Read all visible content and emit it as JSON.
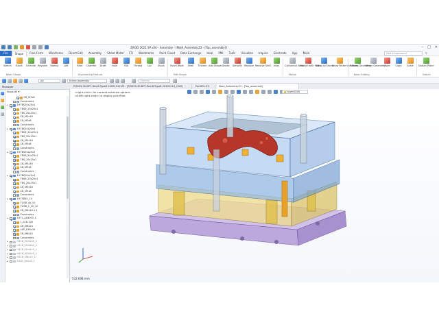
{
  "window": {
    "title": "ZW3D 2021 SP x64 - Assembly - [Mold_Assembly.Z3 - [Top_assembly]]"
  },
  "menu": {
    "file": "File",
    "tabs": [
      "Shape",
      "Free Form",
      "Wireframe",
      "Direct Edit",
      "Assembly",
      "Sheet Metal",
      "FTI",
      "Weldments",
      "Point Cloud",
      "Data Exchange",
      "Heal",
      "PMI",
      "Tools",
      "Visualize",
      "Inquire",
      "Electrode",
      "App",
      "Mold"
    ],
    "active_tab": "Shape",
    "search_placeholder": "Find a command"
  },
  "ribbon": {
    "buttons": [
      "Sketch",
      "Block",
      "Extrude",
      "Revolve",
      "Sweep",
      "Loft",
      "Fillet",
      "Chamfer",
      "Draft",
      "Hole",
      "Rib",
      "Thread",
      "Lip",
      "Stock",
      "Face Offset",
      "Shell",
      "Thicken",
      "Add Shape",
      "Divide",
      "Simplify",
      "Replace",
      "Resolve Self-I",
      "Inlay",
      "Cylindrical Bend",
      "Morph with Point",
      "Wrap to Faces",
      "Wrap Pattern to Faces",
      "Pattern Geometry",
      "Mirror Geometry",
      "Move",
      "Copy",
      "Scale",
      "Datum Plane"
    ],
    "groups": [
      "Basic Shape",
      "Engineering Feature",
      "Edit Shape",
      "Morph",
      "Basic Editing",
      "Datum"
    ]
  },
  "toolbar2": {
    "filter_all": "All",
    "assembly_select": "Entire Assembly",
    "normal_select": "Normal"
  },
  "doc_tabs": [
    "PJ3023-30-BP7-Rev.B-Type8 20201210.Z3 - [PJ3023-30-BP7-Rev.B-Type8 20201210_CAM]",
    "Part001.Z3",
    "Mold_Assembly.Z3 - [Top_assembly]"
  ],
  "active_doc_tab": 2,
  "left_panel": {
    "title": "Manager",
    "filter": "Show All",
    "tree": [
      {
        "label": "CB_M3x8",
        "indent": 2,
        "icon": "part",
        "checked": true
      },
      {
        "label": "Constraints",
        "indent": 1,
        "icon": "cst",
        "checked": false
      },
      {
        "label": "1H7BS20x25x1",
        "indent": 0,
        "icon": "asm",
        "checked": true
      },
      {
        "label": "TBS6_20x25x1",
        "indent": 1,
        "icon": "part",
        "checked": true
      },
      {
        "label": "TBS_20x25x1",
        "indent": 1,
        "icon": "part",
        "checked": true
      },
      {
        "label": "CB_M5x16",
        "indent": 1,
        "icon": "part",
        "checked": true
      },
      {
        "label": "CB_M3x8",
        "indent": 1,
        "icon": "part",
        "checked": true
      },
      {
        "label": "Constraints",
        "indent": 1,
        "icon": "cst",
        "checked": false
      },
      {
        "label": "1H7BS20x25x1",
        "indent": 0,
        "icon": "asm",
        "checked": true
      },
      {
        "label": "TBS6_20x25x1",
        "indent": 1,
        "icon": "part",
        "checked": true
      },
      {
        "label": "TBS_20x25x1",
        "indent": 1,
        "icon": "part",
        "checked": true
      },
      {
        "label": "CB_M5x16",
        "indent": 1,
        "icon": "part",
        "checked": true
      },
      {
        "label": "CB_M3x8",
        "indent": 1,
        "icon": "part",
        "checked": true
      },
      {
        "label": "Constraints",
        "indent": 1,
        "icon": "cst",
        "checked": false
      },
      {
        "label": "1H7BS20x25x1",
        "indent": 0,
        "icon": "asm",
        "checked": true
      },
      {
        "label": "TBS6_20x25x1",
        "indent": 1,
        "icon": "part",
        "checked": true
      },
      {
        "label": "TBS_20x25x1",
        "indent": 1,
        "icon": "part",
        "checked": true
      },
      {
        "label": "CB_M5x16",
        "indent": 1,
        "icon": "part",
        "checked": true
      },
      {
        "label": "CB_M3x8",
        "indent": 1,
        "icon": "part",
        "checked": true
      },
      {
        "label": "Constraints",
        "indent": 1,
        "icon": "cst",
        "checked": false
      },
      {
        "label": "1H7BS20x25x1",
        "indent": 0,
        "icon": "asm",
        "checked": true
      },
      {
        "label": "TBS6_20x25x1",
        "indent": 1,
        "icon": "part",
        "checked": true
      },
      {
        "label": "TBS_20x25x1",
        "indent": 1,
        "icon": "part",
        "checked": true
      },
      {
        "label": "CB_M5x16",
        "indent": 1,
        "icon": "part",
        "checked": true
      },
      {
        "label": "CB_M3x8",
        "indent": 1,
        "icon": "part",
        "checked": true
      },
      {
        "label": "Constraints",
        "indent": 1,
        "icon": "cst",
        "checked": false
      },
      {
        "label": "1H7SB40_10",
        "indent": 0,
        "icon": "asm",
        "checked": true
      },
      {
        "label": "TGSB_40_10",
        "indent": 1,
        "icon": "part",
        "checked": true
      },
      {
        "label": "TGSB_1_40_10",
        "indent": 1,
        "icon": "part",
        "checked": true
      },
      {
        "label": "CB_M6x16 x 4",
        "indent": 1,
        "icon": "part",
        "checked": true
      },
      {
        "label": "Constraints",
        "indent": 1,
        "icon": "cst",
        "checked": false
      },
      {
        "label": "1H7L_A18100_1",
        "indent": 0,
        "icon": "asm",
        "checked": true
      },
      {
        "label": "L_A18-100",
        "indent": 1,
        "icon": "part",
        "checked": true
      },
      {
        "label": "CB_M6x20",
        "indent": 1,
        "icon": "part",
        "checked": true
      },
      {
        "label": "LKP_D18x16",
        "indent": 1,
        "icon": "part",
        "checked": true
      },
      {
        "label": "CB_M6x20",
        "indent": 1,
        "icon": "part",
        "checked": true
      },
      {
        "label": "Constraints",
        "indent": 1,
        "icon": "cst",
        "checked": false
      },
      {
        "label": "H4CB_M16x60_1",
        "indent": 0,
        "icon": "grey",
        "checked": false,
        "dim": true
      },
      {
        "label": "H4CB_M16x60_2",
        "indent": 0,
        "icon": "grey",
        "checked": false,
        "dim": true
      },
      {
        "label": "H4CB_M16x45_1",
        "indent": 0,
        "icon": "grey",
        "checked": false,
        "dim": true
      },
      {
        "label": "H4CB_M16x45_2",
        "indent": 0,
        "icon": "grey",
        "checked": false,
        "dim": true
      },
      {
        "label": "H4CB_M6x10_1",
        "indent": 0,
        "icon": "grey",
        "checked": false,
        "dim": true
      },
      {
        "label": "H4LB_D8x40_1",
        "indent": 0,
        "icon": "grey",
        "checked": false,
        "dim": true
      }
    ]
  },
  "viewport": {
    "hint_1": "<right-click> for context-sensitive options.",
    "hint_2": "<Shift-right-click> to display pick filter.",
    "layer": "Layer0000",
    "status_value": "532.698 mm"
  },
  "colors": {
    "accent": "#2b6cc4",
    "plate_blue": "#7fa8d8",
    "plate_yellow": "#e3cf78",
    "plate_purple": "#a88fd0",
    "part_red": "#c0392b"
  }
}
